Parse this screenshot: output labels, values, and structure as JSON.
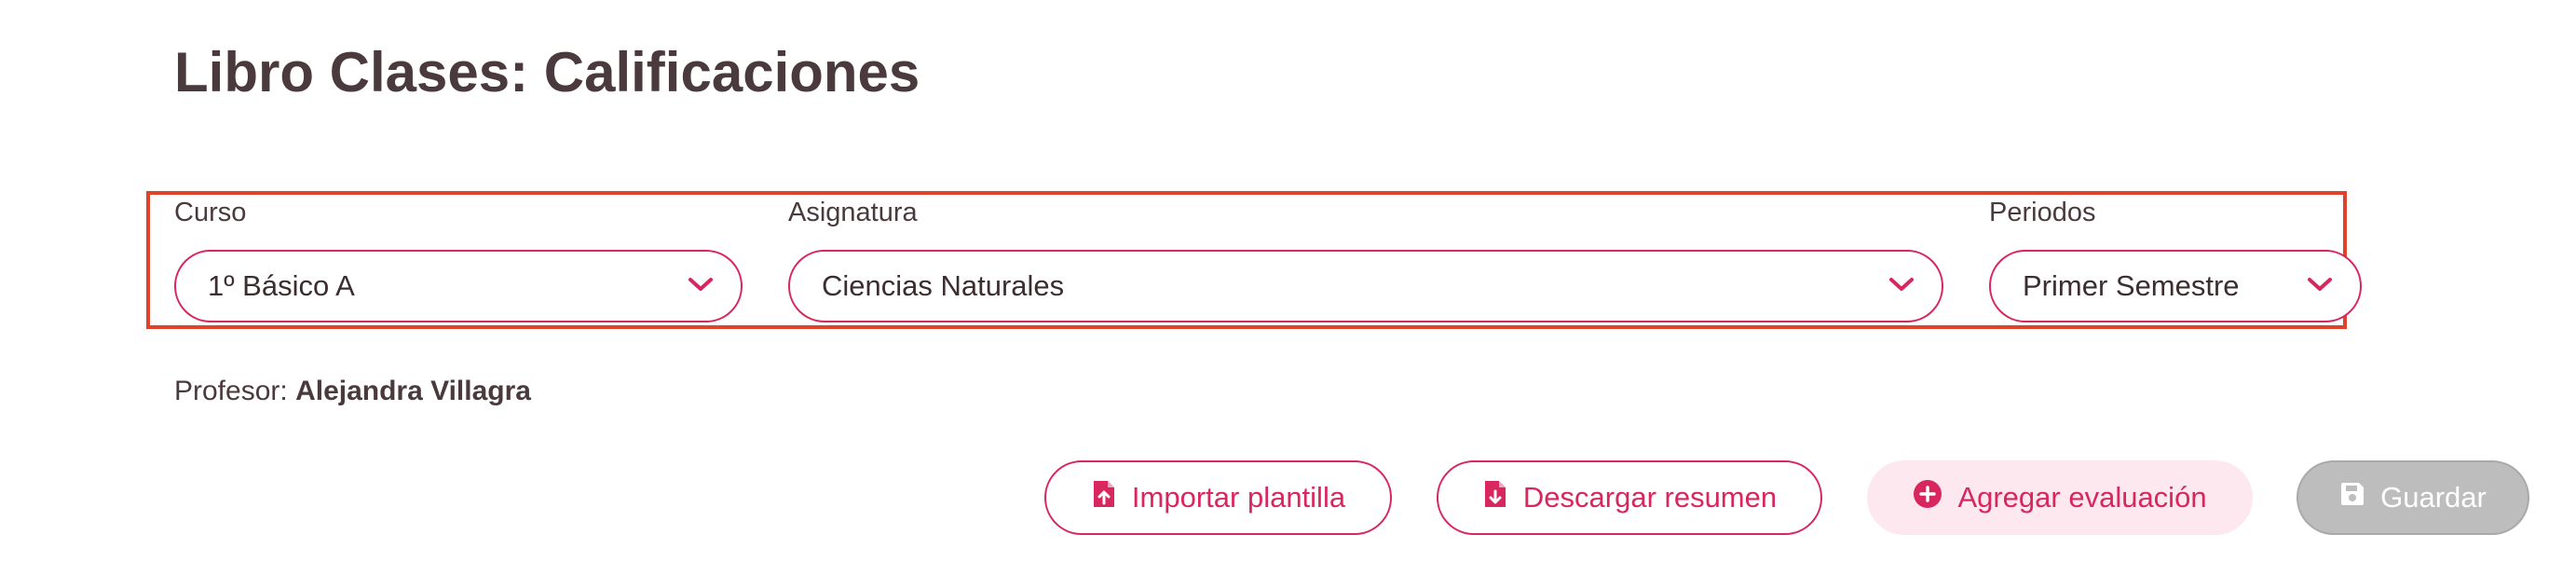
{
  "header": {
    "title": "Libro Clases: Calificaciones"
  },
  "filters": {
    "course": {
      "label": "Curso",
      "value": "1º Básico A"
    },
    "subject": {
      "label": "Asignatura",
      "value": "Ciencias Naturales"
    },
    "period": {
      "label": "Periodos",
      "value": "Primer Semestre"
    }
  },
  "teacher": {
    "label": "Profesor:",
    "name": "Alejandra Villagra"
  },
  "actions": {
    "import_label": "Importar plantilla",
    "download_label": "Descargar resumen",
    "add_label": "Agregar evaluación",
    "save_label": "Guardar"
  },
  "colors": {
    "accent": "#d8265f",
    "highlight_border": "#e0432b",
    "soft_button_bg": "#fde8ef",
    "disabled_bg": "#bdbdbd",
    "text": "#4a3a3d"
  },
  "icons": [
    "chevron-down-icon",
    "file-import-icon",
    "file-download-icon",
    "plus-circle-icon",
    "save-icon"
  ]
}
